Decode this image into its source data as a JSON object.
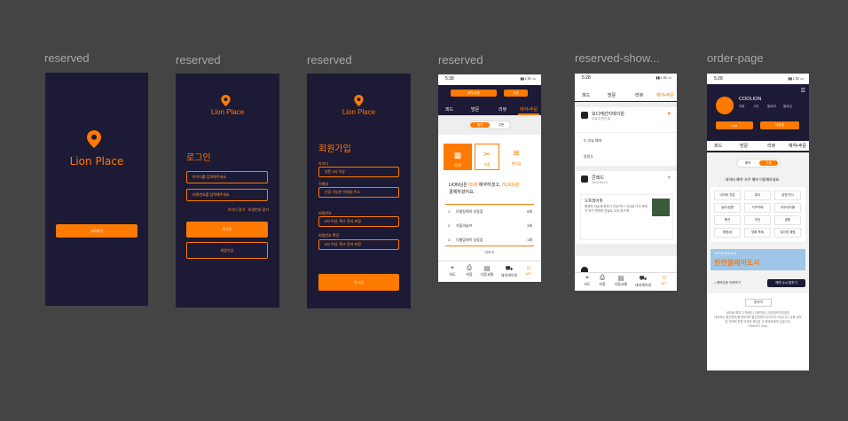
{
  "colors": {
    "canvas": "#444444",
    "dark": "#1d1a35",
    "accent": "#ff7a00",
    "label": "#a8a8a8"
  },
  "frames": [
    {
      "label": "reserved"
    },
    {
      "label": "reserved"
    },
    {
      "label": "reserved"
    },
    {
      "label": "reserved"
    },
    {
      "label": "reserved-show..."
    },
    {
      "label": "order-page"
    }
  ],
  "splash": {
    "logo": "Lion Place",
    "button": "시작하기"
  },
  "login": {
    "logo": "Lion Place",
    "title": "로그인",
    "id_placeholder": "아이디를 입력해주세요",
    "pw_placeholder": "비밀번호를 입력해주세요",
    "links": "아이디 찾기 · 비밀번호 찾기",
    "login_btn": "로그인",
    "signup_btn": "회원가입"
  },
  "signup": {
    "logo": "Lion Place",
    "title": "회원가입",
    "fields": [
      {
        "label": "아이디",
        "placeholder": "영문 4자 이상"
      },
      {
        "label": "이메일",
        "placeholder": "인증 가능한 이메일 주소"
      },
      {
        "label": "비밀번호",
        "placeholder": "6자 이상, 특수 문자 포함"
      },
      {
        "label": "비밀번호 확인",
        "placeholder": "6자 이상, 특수 문자 포함"
      }
    ],
    "submit": "로그인"
  },
  "reserved": {
    "time": "5:38",
    "tabs": [
      "피드",
      "방문",
      "리뷰",
      "예약•주문"
    ],
    "top_btns": [
      "예약•주문",
      "주문"
    ],
    "toggle": [
      "예약",
      "주문"
    ],
    "cats": [
      "전체",
      "미용",
      "편의점"
    ],
    "summary_prefix": "LION님은 ",
    "summary_count": "55회",
    "summary_mid": " 예약하셨고, ",
    "summary_amount": "76,000원",
    "summary_suffix": "결제하셨어요.",
    "rows": [
      {
        "num": "1",
        "name": "모발장해의 성동점",
        "count": "5회"
      },
      {
        "num": "2",
        "name": "가을의술프",
        "count": "3회"
      },
      {
        "num": "3",
        "name": "더웹업헤이 성동점",
        "count": "1회"
      }
    ],
    "more": "더보기",
    "nav": [
      "지도",
      "저장",
      "다움교통",
      "내비게이션",
      "MY"
    ]
  },
  "show": {
    "time": "5:28",
    "tabs": [
      "피드",
      "방문",
      "리뷰",
      "예약•주문"
    ],
    "card1_title": "모디케선지데이원",
    "card1_sub": "오늘의 편지 통",
    "card1_tag": "알람도",
    "card2_title": "콘레드",
    "card2_sub": "2023.05.19",
    "review_title": "오프레어핏",
    "review_text": "향해우 셔돈에 피하기 인당7만Y 이너분 다우 육비가 먹기 편하여 안달르 소리 피드백",
    "nav": [
      "지도",
      "저장",
      "다움교통",
      "내비게이션",
      "MY"
    ]
  },
  "order": {
    "time": "5:28",
    "username": "COOLION",
    "stats": [
      "리뷰",
      "사진",
      "팔로워",
      "팔로잉"
    ],
    "btns": [
      "Lart",
      "네방명"
    ],
    "tabs": [
      "피드",
      "방문",
      "리뷰",
      "예약•주문"
    ],
    "toggle": [
      "예약",
      "주문"
    ],
    "heading": "'네이버 예약' 자주 예약 이용해보세요.",
    "cats": [
      "네이버 지갑",
      "뷰티",
      "공연/전시",
      "놀이/공원",
      "키즈카페",
      "아무데이블",
      "펜션",
      "오던",
      "캠핑",
      "체험/공",
      "영화 축제",
      "집이방 체험"
    ],
    "banner_small": "도프 에 전국 소시",
    "banner_big": "핀란플레이도시",
    "foot_left": "예약주문 이력보기",
    "foot_right": "예약 수시 맞추기",
    "select": "한국어",
    "footer": "네이버 예약 고객센터 | 이용약관 | 개인정보처리방침\n네이버는 통신판매 중개자이며 통신판매의 당사자가 아닙니다. 상품 정보 및 거래에 관한 의무와 책임은 각 판매자에게 있습니다.\n©NAVER Corp."
  }
}
